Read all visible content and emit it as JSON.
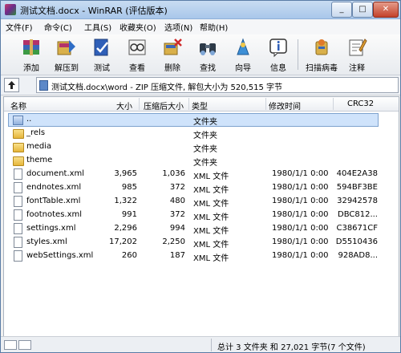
{
  "window": {
    "title": "测试文档.docx - WinRAR (评估版本)"
  },
  "menu": [
    "文件(F)",
    "命令(C)",
    "工具(S)",
    "收藏夹(O)",
    "选项(N)",
    "帮助(H)"
  ],
  "toolbar": [
    {
      "label": "添加",
      "icon": "add-archive-icon"
    },
    {
      "label": "解压到",
      "icon": "extract-to-icon"
    },
    {
      "label": "测试",
      "icon": "test-icon"
    },
    {
      "label": "查看",
      "icon": "view-icon"
    },
    {
      "label": "删除",
      "icon": "delete-icon"
    },
    {
      "label": "查找",
      "icon": "find-icon"
    },
    {
      "label": "向导",
      "icon": "wizard-icon"
    },
    {
      "label": "信息",
      "icon": "info-icon"
    },
    {
      "label": "扫描病毒",
      "icon": "virus-scan-icon"
    },
    {
      "label": "注释",
      "icon": "comment-icon"
    }
  ],
  "address": {
    "path": "测试文档.docx\\word - ZIP 压缩文件, 解包大小为 520,515 字节"
  },
  "columns": [
    "名称",
    "大小",
    "压缩后大小",
    "类型",
    "修改时间",
    "CRC32"
  ],
  "rows": [
    {
      "name": "..",
      "size": "",
      "packed": "",
      "type": "文件夹",
      "modified": "",
      "crc": "",
      "kind": "updir"
    },
    {
      "name": "_rels",
      "size": "",
      "packed": "",
      "type": "文件夹",
      "modified": "",
      "crc": "",
      "kind": "folder"
    },
    {
      "name": "media",
      "size": "",
      "packed": "",
      "type": "文件夹",
      "modified": "",
      "crc": "",
      "kind": "folder"
    },
    {
      "name": "theme",
      "size": "",
      "packed": "",
      "type": "文件夹",
      "modified": "",
      "crc": "",
      "kind": "folder"
    },
    {
      "name": "document.xml",
      "size": "3,965",
      "packed": "1,036",
      "type": "XML 文件",
      "modified": "1980/1/1 0:00",
      "crc": "404E2A38",
      "kind": "doc"
    },
    {
      "name": "endnotes.xml",
      "size": "985",
      "packed": "372",
      "type": "XML 文件",
      "modified": "1980/1/1 0:00",
      "crc": "594BF3BE",
      "kind": "doc"
    },
    {
      "name": "fontTable.xml",
      "size": "1,322",
      "packed": "480",
      "type": "XML 文件",
      "modified": "1980/1/1 0:00",
      "crc": "32942578",
      "kind": "doc"
    },
    {
      "name": "footnotes.xml",
      "size": "991",
      "packed": "372",
      "type": "XML 文件",
      "modified": "1980/1/1 0:00",
      "crc": "DBC812...",
      "kind": "doc"
    },
    {
      "name": "settings.xml",
      "size": "2,296",
      "packed": "994",
      "type": "XML 文件",
      "modified": "1980/1/1 0:00",
      "crc": "C38671CF",
      "kind": "doc"
    },
    {
      "name": "styles.xml",
      "size": "17,202",
      "packed": "2,250",
      "type": "XML 文件",
      "modified": "1980/1/1 0:00",
      "crc": "D5510436",
      "kind": "doc"
    },
    {
      "name": "webSettings.xml",
      "size": "260",
      "packed": "187",
      "type": "XML 文件",
      "modified": "1980/1/1 0:00",
      "crc": "928AD8...",
      "kind": "doc"
    }
  ],
  "status": {
    "summary": "总计 3 文件夹 和 27,021 字节(7 个文件)"
  }
}
